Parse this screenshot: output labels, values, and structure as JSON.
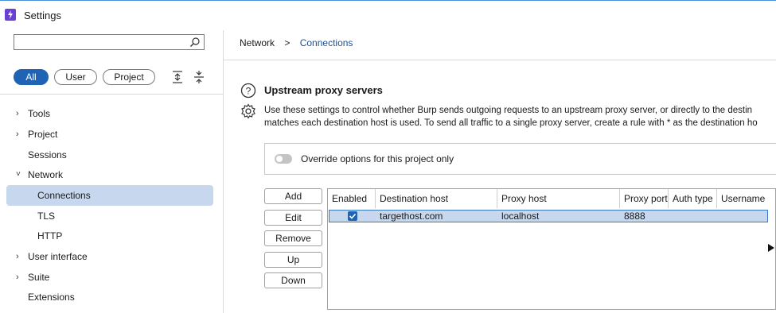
{
  "window": {
    "title": "Settings"
  },
  "search": {
    "placeholder": "",
    "value": ""
  },
  "filters": {
    "all": "All",
    "user": "User",
    "project": "Project"
  },
  "nav": {
    "tools": "Tools",
    "project": "Project",
    "sessions": "Sessions",
    "network": "Network",
    "connections": "Connections",
    "tls": "TLS",
    "http": "HTTP",
    "user_interface": "User interface",
    "suite": "Suite",
    "extensions": "Extensions"
  },
  "breadcrumb": {
    "parent": "Network",
    "separator": ">",
    "current": "Connections"
  },
  "section": {
    "title": "Upstream proxy servers",
    "desc_line1": "Use these settings to  control whether Burp sends outgoing requests to an upstream proxy server, or directly to the destin",
    "desc_line2": "matches each destination host is used. To send all traffic to a single proxy server, create a rule with * as the destination ho"
  },
  "override": {
    "label": "Override options for this project only",
    "enabled": false
  },
  "buttons": {
    "add": "Add",
    "edit": "Edit",
    "remove": "Remove",
    "up": "Up",
    "down": "Down"
  },
  "table": {
    "headers": {
      "enabled": "Enabled",
      "dest": "Destination host",
      "proxy_host": "Proxy host",
      "proxy_port": "Proxy port",
      "auth": "Auth type",
      "username": "Username"
    },
    "rows": [
      {
        "enabled": true,
        "dest": "targethost.com",
        "proxy_host": "localhost",
        "proxy_port": "8888",
        "auth": "",
        "username": ""
      }
    ]
  },
  "colors": {
    "accent": "#1f63b5",
    "selection": "#c7d8ee",
    "brand": "#6a3fd6"
  }
}
